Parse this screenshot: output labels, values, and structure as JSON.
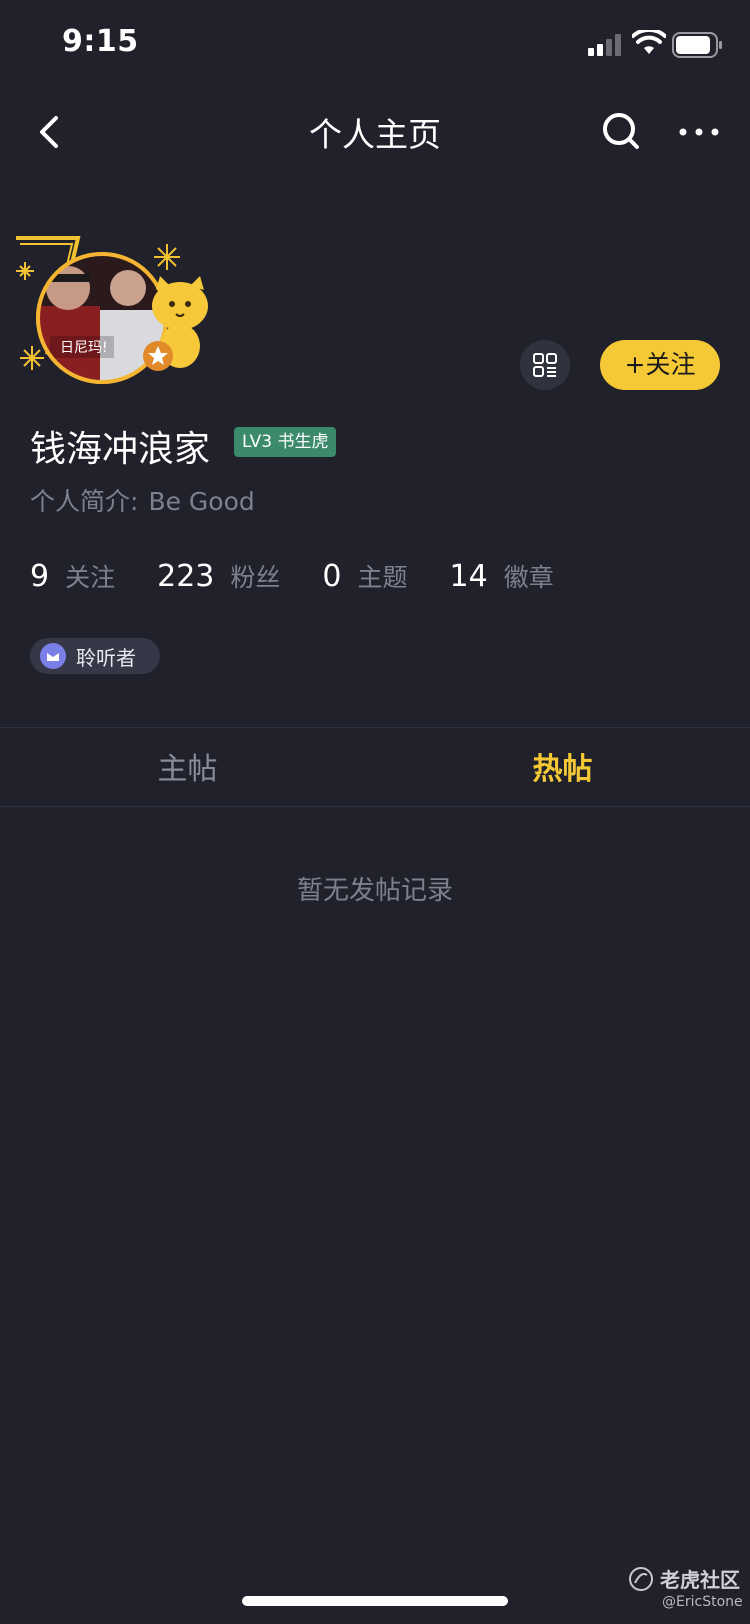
{
  "status_bar": {
    "time": "9:15"
  },
  "nav": {
    "title": "个人主页"
  },
  "profile": {
    "avatar_caption": "日尼玛!",
    "name": "钱海冲浪家",
    "level": "LV3 书生虎",
    "bio_label": "个人简介:",
    "bio_value": "Be Good",
    "follow_label": "+关注",
    "stats": [
      {
        "num": "9",
        "label": "关注"
      },
      {
        "num": "223",
        "label": "粉丝"
      },
      {
        "num": "0",
        "label": "主题"
      },
      {
        "num": "14",
        "label": "徽章"
      }
    ],
    "tag": "聆听者"
  },
  "tabs": [
    {
      "label": "主帖",
      "active": false
    },
    {
      "label": "热帖",
      "active": true
    }
  ],
  "empty_text": "暂无发帖记录",
  "watermark": {
    "brand": "老虎社区",
    "user": "@EricStone"
  },
  "colors": {
    "background": "#20212b",
    "accent": "#f5c935",
    "level_badge": "#3b8a6c",
    "muted": "#7e8090"
  }
}
